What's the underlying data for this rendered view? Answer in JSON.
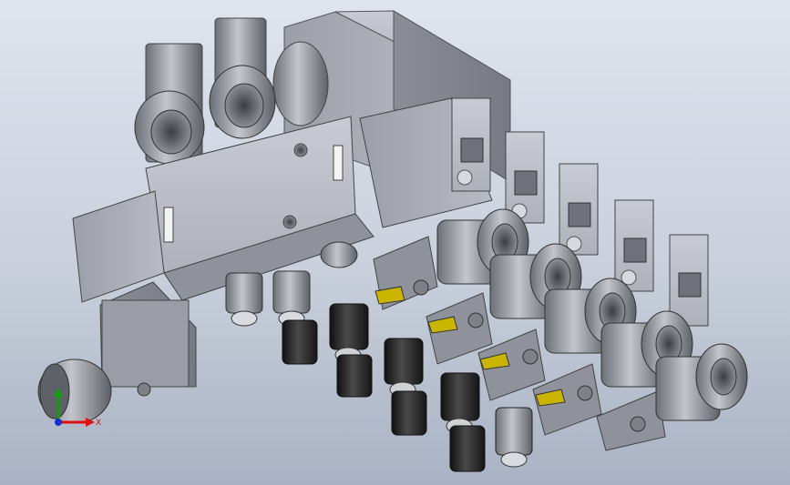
{
  "viewport": {
    "background_top": "#dfe4ee",
    "background_bottom": "#a9b2c4"
  },
  "model": {
    "part_color": "#a8abb5",
    "indicator_color": "#c9b500",
    "fitting_dark": "#2a2a2a",
    "fitting_grey": "#7d7f84",
    "valve_count": 5
  },
  "triad": {
    "x_label": "X",
    "x_color": "#e01010",
    "y_color": "#10a010",
    "z_color": "#1030d0"
  }
}
